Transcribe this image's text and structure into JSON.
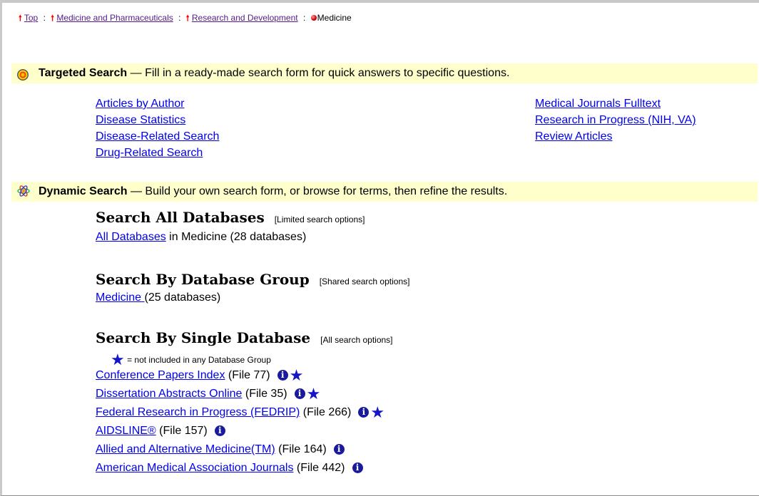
{
  "breadcrumb": {
    "items": [
      "Top",
      "Medicine and Pharmaceuticals",
      "Research and Development"
    ],
    "separator": ":",
    "current": "Medicine"
  },
  "targeted": {
    "title": "Targeted Search",
    "description": "— Fill in a ready-made search form for quick answers to specific questions.",
    "left_links": [
      "Articles by Author",
      "Disease Statistics",
      "Disease-Related Search",
      "Drug-Related Search"
    ],
    "right_links": [
      "Medical Journals Fulltext",
      "Research in Progress (NIH, VA)",
      "Review Articles"
    ]
  },
  "dynamic": {
    "title": "Dynamic Search",
    "description": "— Build your own search form, or browse for terms, then refine the results.",
    "all": {
      "heading": "Search All Databases",
      "note": "[Limited search options]",
      "link": "All Databases",
      "suffix": " in Medicine (28 databases)"
    },
    "group": {
      "heading": "Search By Database Group",
      "note": "[Shared search options]",
      "link": "Medicine ",
      "suffix": "(25 databases)"
    },
    "single": {
      "heading": "Search By Single Database",
      "note": "[All search options]",
      "legend": "= not included in any Database Group",
      "databases": [
        {
          "name": "Conference Papers Index",
          "file": "(File 77)"
        },
        {
          "name": "Dissertation Abstracts Online",
          "file": "(File 35)"
        },
        {
          "name": "Federal Research in Progress (FEDRIP)",
          "file": "(File 266)"
        },
        {
          "name": "AIDSLINE®",
          "file": "(File 157)"
        },
        {
          "name": "Allied and Alternative Medicine(TM)",
          "file": "(File 164)"
        },
        {
          "name": "American Medical Association Journals",
          "file": "(File 442)"
        }
      ]
    }
  },
  "icons": {
    "up_arrow": "up-arrow-icon",
    "info": "i",
    "star": "★",
    "targeted": "target-icon",
    "dynamic": "atom-icon"
  },
  "colors": {
    "banner": "#ffffcc",
    "link": "#0000ee",
    "visited": "#551a8b",
    "star": "#1515c8"
  }
}
